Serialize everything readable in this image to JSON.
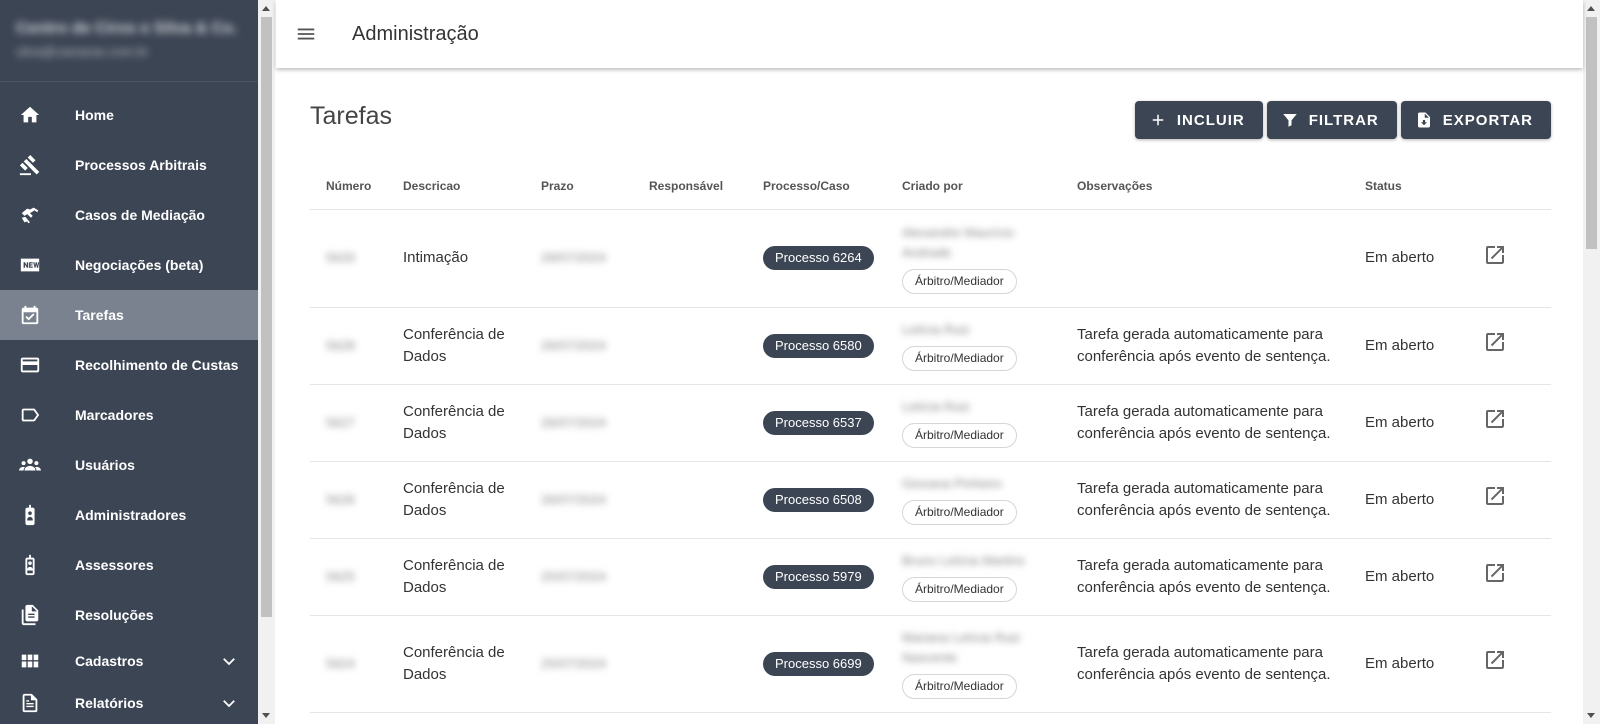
{
  "sidebar": {
    "user_name": "Centro de Ciros e Silva & Co.",
    "user_email": "silva@camaras.com.br",
    "items": [
      {
        "label": "Home",
        "icon": "home-icon"
      },
      {
        "label": "Processos Arbitrais",
        "icon": "gavel-icon"
      },
      {
        "label": "Casos de Mediação",
        "icon": "handshake-icon"
      },
      {
        "label": "Negociações (beta)",
        "icon": "new-badge-icon"
      },
      {
        "label": "Tarefas",
        "icon": "calendar-check-icon"
      },
      {
        "label": "Recolhimento de Custas",
        "icon": "credit-card-icon"
      },
      {
        "label": "Marcadores",
        "icon": "label-icon"
      },
      {
        "label": "Usuários",
        "icon": "people-icon"
      },
      {
        "label": "Administradores",
        "icon": "badge-icon"
      },
      {
        "label": "Assessores",
        "icon": "badge-icon"
      },
      {
        "label": "Resoluções",
        "icon": "documents-icon"
      },
      {
        "label": "Cadastros",
        "icon": "grid-icon"
      },
      {
        "label": "Relatórios",
        "icon": "report-icon"
      }
    ],
    "active_index": 4
  },
  "topbar": {
    "title": "Administração"
  },
  "page": {
    "title": "Tarefas",
    "buttons": {
      "include": "INCLUIR",
      "filter": "FILTRAR",
      "export": "EXPORTAR"
    }
  },
  "table": {
    "headers": [
      "Número",
      "Descricao",
      "Prazo",
      "Responsável",
      "Processo/Caso",
      "Criado por",
      "Observações",
      "Status"
    ],
    "rows": [
      {
        "numero": "5633",
        "descricao": "Intimação",
        "prazo": "29/07/2024",
        "responsavel": "",
        "processo": "Processo 6264",
        "criado_por": "Alexandre Maurício Andrade",
        "papel": "Árbitro/Mediador",
        "observacoes": "",
        "status": "Em aberto"
      },
      {
        "numero": "5628",
        "descricao": "Conferência de Dados",
        "prazo": "26/07/2024",
        "responsavel": "",
        "processo": "Processo 6580",
        "criado_por": "Letícia Ruiz",
        "papel": "Árbitro/Mediador",
        "observacoes": "Tarefa gerada automaticamente para conferência após evento de sentença.",
        "status": "Em aberto"
      },
      {
        "numero": "5627",
        "descricao": "Conferência de Dados",
        "prazo": "26/07/2024",
        "responsavel": "",
        "processo": "Processo 6537",
        "criado_por": "Letícia Ruiz",
        "papel": "Árbitro/Mediador",
        "observacoes": "Tarefa gerada automaticamente para conferência após evento de sentença.",
        "status": "Em aberto"
      },
      {
        "numero": "5626",
        "descricao": "Conferência de Dados",
        "prazo": "26/07/2024",
        "responsavel": "",
        "processo": "Processo 6508",
        "criado_por": "Giovana Pinheiro",
        "papel": "Árbitro/Mediador",
        "observacoes": "Tarefa gerada automaticamente para conferência após evento de sentença.",
        "status": "Em aberto"
      },
      {
        "numero": "5625",
        "descricao": "Conferência de Dados",
        "prazo": "25/07/2024",
        "responsavel": "",
        "processo": "Processo 5979",
        "criado_por": "Bruno Letícia Martins",
        "papel": "Árbitro/Mediador",
        "observacoes": "Tarefa gerada automaticamente para conferência após evento de sentença.",
        "status": "Em aberto"
      },
      {
        "numero": "5624",
        "descricao": "Conferência de Dados",
        "prazo": "25/07/2024",
        "responsavel": "",
        "processo": "Processo 6699",
        "criado_por": "Mariana Letícia Ruiz Nascente",
        "papel": "Árbitro/Mediador",
        "observacoes": "Tarefa gerada automaticamente para conferência após evento de sentença.",
        "status": "Em aberto"
      }
    ]
  },
  "colors": {
    "sidebar_bg": "#3c4554",
    "sidebar_active": "#7a8290",
    "button_bg": "#3c4554"
  }
}
